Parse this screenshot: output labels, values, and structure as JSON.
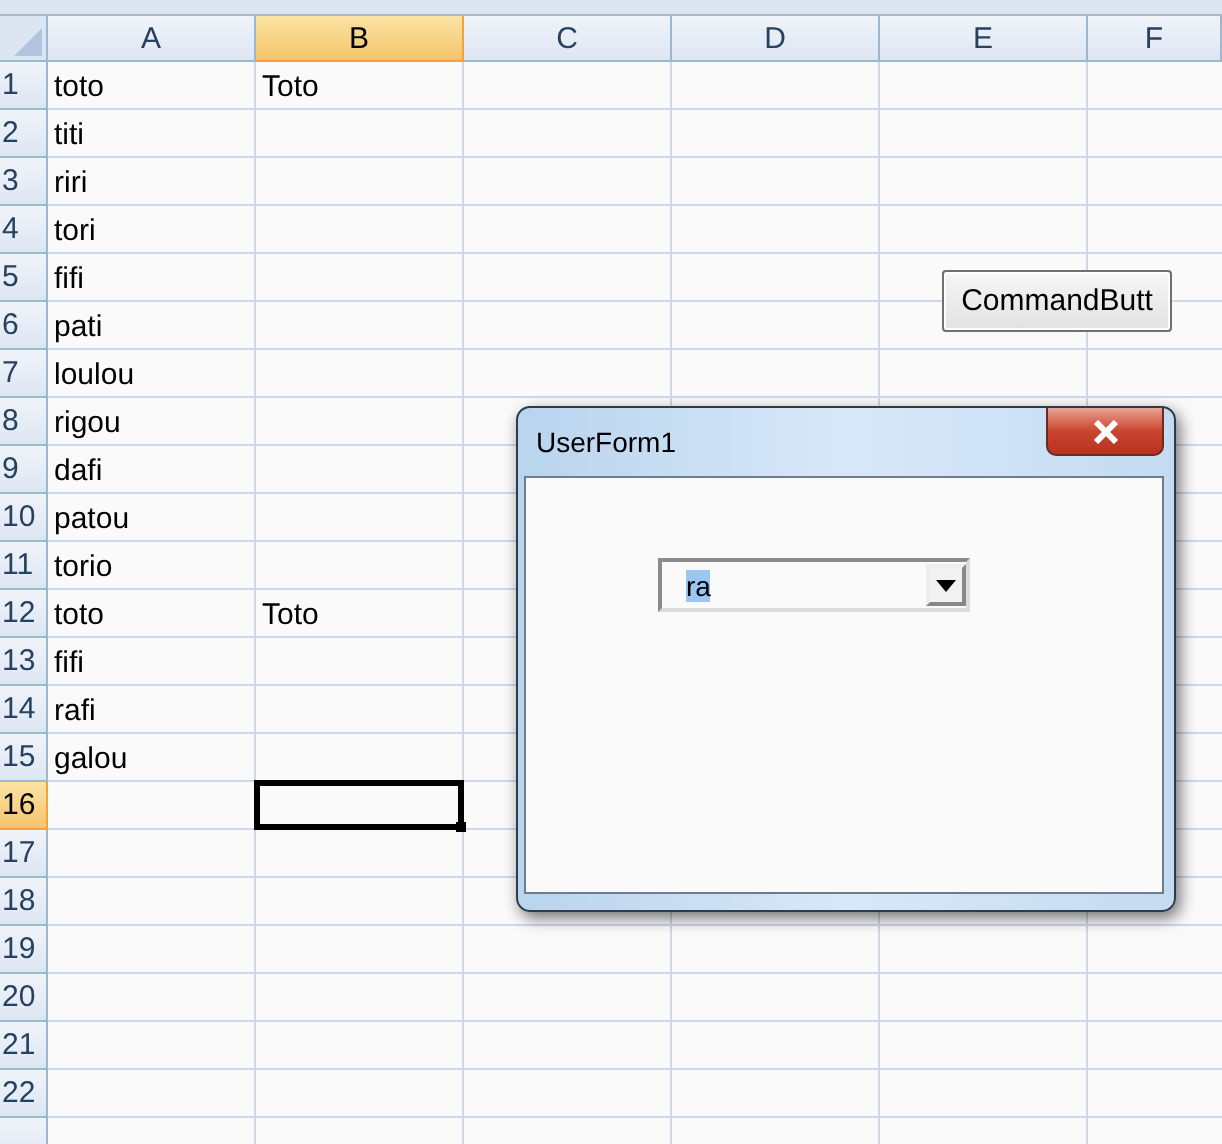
{
  "sheet": {
    "columns": [
      {
        "label": "A",
        "selected": false
      },
      {
        "label": "B",
        "selected": true
      },
      {
        "label": "C",
        "selected": false
      },
      {
        "label": "D",
        "selected": false
      },
      {
        "label": "E",
        "selected": false
      },
      {
        "label": "F",
        "selected": false
      }
    ],
    "rows": [
      {
        "label": "1",
        "selected": false,
        "cells": [
          {
            "text": "toto",
            "selected": false
          },
          {
            "text": "Toto",
            "selected": false
          }
        ]
      },
      {
        "label": "2",
        "selected": false,
        "cells": [
          {
            "text": "titi",
            "selected": false
          },
          {
            "selected": false
          }
        ]
      },
      {
        "label": "3",
        "selected": false,
        "cells": [
          {
            "text": "riri",
            "selected": false
          },
          {
            "selected": false
          }
        ]
      },
      {
        "label": "4",
        "selected": false,
        "cells": [
          {
            "text": "tori",
            "selected": false
          },
          {
            "selected": false
          }
        ]
      },
      {
        "label": "5",
        "selected": false,
        "cells": [
          {
            "text": "fifi",
            "selected": false
          },
          {
            "selected": false
          }
        ]
      },
      {
        "label": "6",
        "selected": false,
        "cells": [
          {
            "text": "pati",
            "selected": false
          },
          {
            "selected": false
          }
        ]
      },
      {
        "label": "7",
        "selected": false,
        "cells": [
          {
            "text": "loulou",
            "selected": false
          },
          {
            "selected": false
          }
        ]
      },
      {
        "label": "8",
        "selected": false,
        "cells": [
          {
            "text": "rigou",
            "selected": false
          },
          {
            "selected": false
          }
        ]
      },
      {
        "label": "9",
        "selected": false,
        "cells": [
          {
            "text": "dafi",
            "selected": false
          },
          {
            "selected": false
          }
        ]
      },
      {
        "label": "10",
        "selected": false,
        "cells": [
          {
            "text": "patou",
            "selected": false
          },
          {
            "selected": false
          }
        ]
      },
      {
        "label": "11",
        "selected": false,
        "cells": [
          {
            "text": "torio",
            "selected": false
          },
          {
            "selected": false
          }
        ]
      },
      {
        "label": "12",
        "selected": false,
        "cells": [
          {
            "text": "toto",
            "selected": false
          },
          {
            "text": "Toto",
            "selected": false
          }
        ]
      },
      {
        "label": "13",
        "selected": false,
        "cells": [
          {
            "text": "fifi",
            "selected": false
          },
          {
            "selected": false
          }
        ]
      },
      {
        "label": "14",
        "selected": false,
        "cells": [
          {
            "text": "rafi",
            "selected": false
          },
          {
            "selected": false
          }
        ]
      },
      {
        "label": "15",
        "selected": false,
        "cells": [
          {
            "text": "galou",
            "selected": false
          },
          {
            "selected": false
          }
        ]
      },
      {
        "label": "16",
        "selected": true,
        "cells": [
          {
            "selected": false
          },
          {
            "selected": true
          }
        ]
      },
      {
        "label": "17",
        "selected": false,
        "cells": [
          {
            "selected": false
          },
          {
            "selected": false
          }
        ]
      },
      {
        "label": "18",
        "selected": false,
        "cells": [
          {
            "selected": false
          },
          {
            "selected": false
          }
        ]
      },
      {
        "label": "19",
        "selected": false,
        "cells": [
          {
            "selected": false
          },
          {
            "selected": false
          }
        ]
      },
      {
        "label": "20",
        "selected": false,
        "cells": [
          {
            "selected": false
          },
          {
            "selected": false
          }
        ]
      },
      {
        "label": "21",
        "selected": false,
        "cells": [
          {
            "selected": false
          },
          {
            "selected": false
          }
        ]
      },
      {
        "label": "22",
        "selected": false,
        "cells": [
          {
            "selected": false
          },
          {
            "selected": false
          }
        ]
      }
    ]
  },
  "command_button": {
    "label": "CommandButt"
  },
  "userform": {
    "title": "UserForm1",
    "combobox": {
      "value": "ra",
      "text_selected": true
    }
  }
}
